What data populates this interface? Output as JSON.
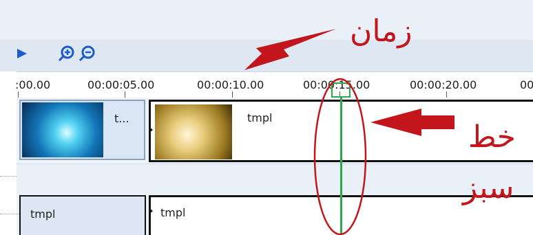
{
  "toolbar": {
    "play_icon": "play-icon",
    "zoom_in_icon": "zoom-in-icon",
    "zoom_out_icon": "zoom-out-icon",
    "accent_color": "#1a5bd0"
  },
  "ruler": {
    "labels": [
      ":00.00",
      "00:00:05.00",
      "00:00:10.00",
      "00:00:15.00",
      "00:00:20.00",
      "00"
    ]
  },
  "track1": {
    "clip_small_label": "t...",
    "clip_big_label": "tmpl"
  },
  "track3": {
    "clip_left_label": "tmpl",
    "clip_right_label": "tmpl"
  },
  "annotations": {
    "zaman": "زمان",
    "khat": "خط",
    "sabz": "سبز",
    "color": "#c2161c",
    "playhead_color": "#2da84a"
  }
}
